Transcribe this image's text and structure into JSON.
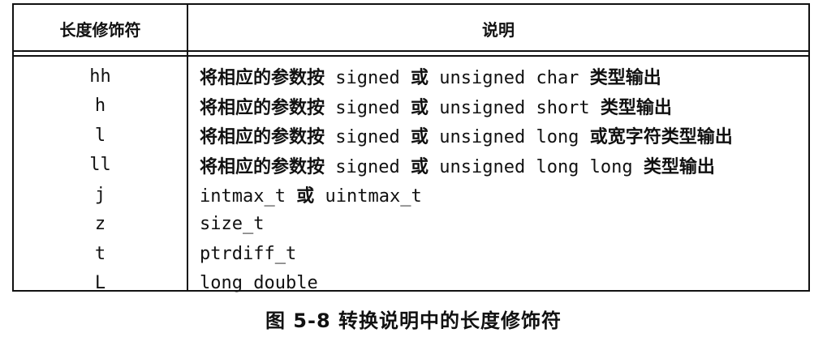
{
  "table": {
    "headers": [
      "长度修饰符",
      "说明"
    ],
    "rows": [
      {
        "modifier": "hh",
        "desc": "将相应的参数按 signed 或 unsigned char 类型输出"
      },
      {
        "modifier": "h",
        "desc": "将相应的参数按 signed 或 unsigned short 类型输出"
      },
      {
        "modifier": "l",
        "desc": "将相应的参数按 signed 或 unsigned long 或宽字符类型输出"
      },
      {
        "modifier": "ll",
        "desc": "将相应的参数按 signed 或 unsigned long long 类型输出"
      },
      {
        "modifier": "j",
        "desc": "intmax_t 或 uintmax_t"
      },
      {
        "modifier": "z",
        "desc": "size_t"
      },
      {
        "modifier": "t",
        "desc": "ptrdiff_t"
      },
      {
        "modifier": "L",
        "desc": "long double"
      }
    ]
  },
  "caption": "图 5-8 转换说明中的长度修饰符"
}
